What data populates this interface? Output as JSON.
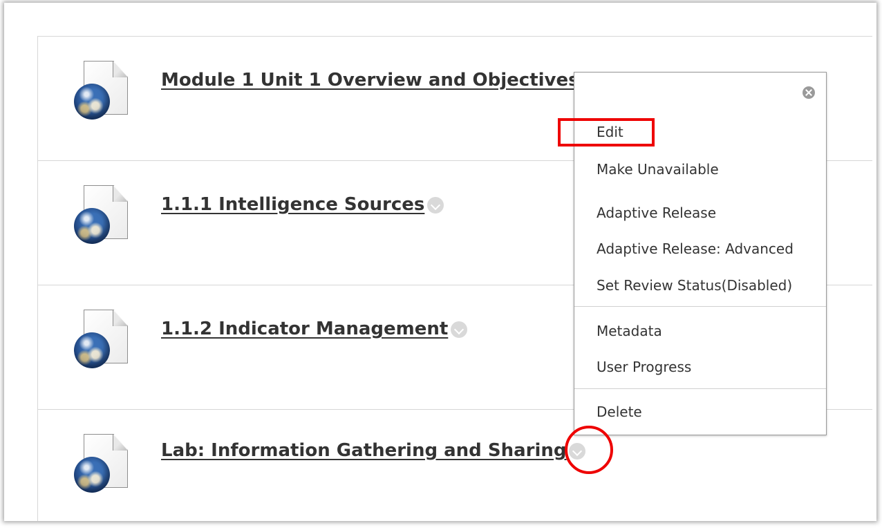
{
  "content_items": [
    {
      "title": "Module 1 Unit 1 Overview and Objectives",
      "icon": "web-document-icon"
    },
    {
      "title": "1.1.1 Intelligence Sources",
      "icon": "web-document-icon"
    },
    {
      "title": "1.1.2 Indicator Management",
      "icon": "web-document-icon"
    },
    {
      "title": "Lab: Information Gathering and Sharing",
      "icon": "web-document-icon"
    }
  ],
  "context_menu": {
    "close_icon": "close-circle-icon",
    "items": [
      {
        "label": "Edit"
      },
      {
        "label": "Make Unavailable"
      },
      {
        "label": "Adaptive Release"
      },
      {
        "label": "Adaptive Release: Advanced"
      },
      {
        "label": "Set Review Status(Disabled)"
      },
      {
        "label": "Metadata"
      },
      {
        "label": "User Progress"
      },
      {
        "label": "Delete"
      }
    ]
  },
  "annotation_color": "#ee0000"
}
